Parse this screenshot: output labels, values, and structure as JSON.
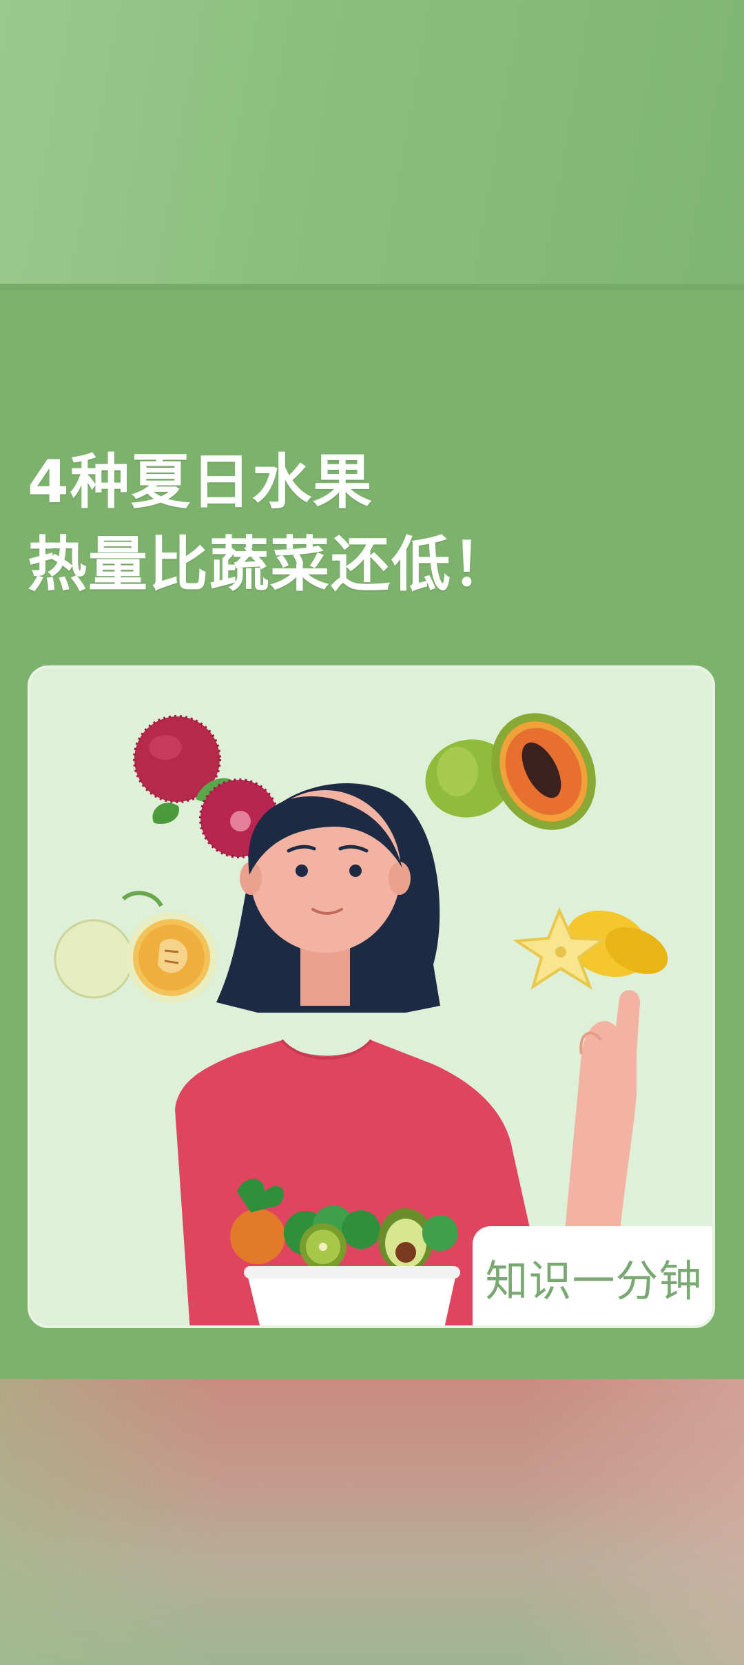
{
  "headline": {
    "line1": "4种夏日水果",
    "line2": "热量比蔬菜还低！"
  },
  "badge": {
    "text": "知识一分钟"
  },
  "illustration": {
    "fruits": [
      "bayberry",
      "papaya",
      "cantaloupe",
      "starfruit"
    ],
    "bowl": "salad-bowl",
    "colors": {
      "card_bg": "#dff0d8",
      "shirt": "#e0455f",
      "hair": "#1c2a44",
      "skin": "#f2b3a2"
    }
  }
}
